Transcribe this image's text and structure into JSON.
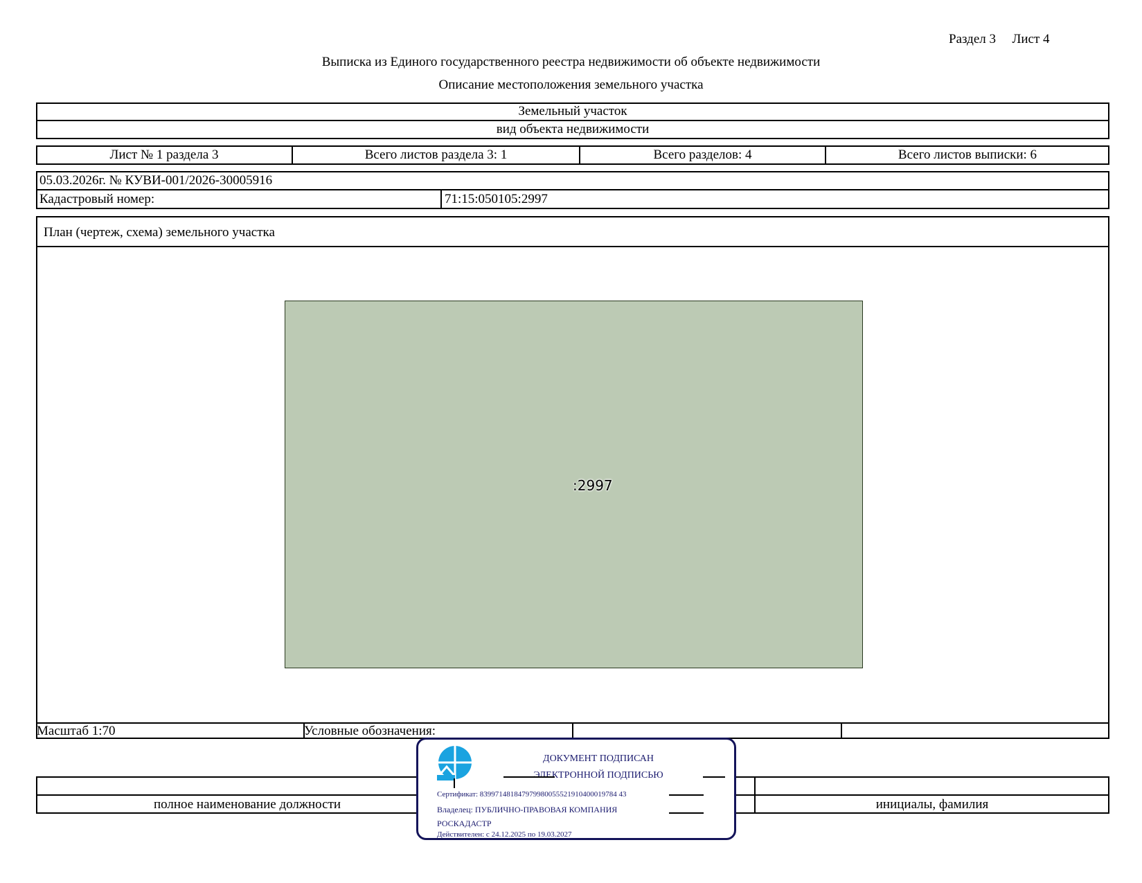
{
  "header": {
    "section": "Раздел 3",
    "sheet": "Лист 4",
    "title": "Выписка из Единого государственного реестра недвижимости об объекте недвижимости",
    "subtitle": "Описание местоположения земельного участка"
  },
  "object": {
    "type": "Земельный участок",
    "type_caption": "вид объекта недвижимости"
  },
  "sheets": {
    "sheet_no": "Лист № 1 раздела 3",
    "total_section_sheets": "Всего листов раздела 3: 1",
    "total_sections": "Всего разделов: 4",
    "total_extract_sheets": "Всего листов выписки: 6"
  },
  "doc": {
    "date_number": "05.03.2026г. № КУВИ-001/2026-30005916",
    "cadastral_label": "Кадастровый номер:",
    "cadastral_value": "71:15:050105:2997"
  },
  "plan": {
    "title": "План (чертеж, схема) земельного участка",
    "parcel_label": ":2997",
    "parcel_fill": "#bccab4",
    "scale": "Масштаб 1:70",
    "legend": "Условные обозначения:"
  },
  "signature": {
    "position_caption": "полное наименование должности",
    "name_caption": "инициалы, фамилия"
  },
  "stamp": {
    "line1": "ДОКУМЕНТ ПОДПИСАН",
    "line2": "ЭЛЕКТРОННОЙ ПОДПИСЬЮ",
    "certificate": "Сертификат: 839971481847979980055521910400019784 43",
    "owner": "Владелец: ПУБЛИЧНО-ПРАВОВАЯ КОМПАНИЯ",
    "owner2": "РОСКАДАСТР",
    "valid": "Действителен: с 24.12.2025 по 19.03.2027",
    "border_color": "#14145a",
    "logo_color": "#1aa3e0"
  }
}
